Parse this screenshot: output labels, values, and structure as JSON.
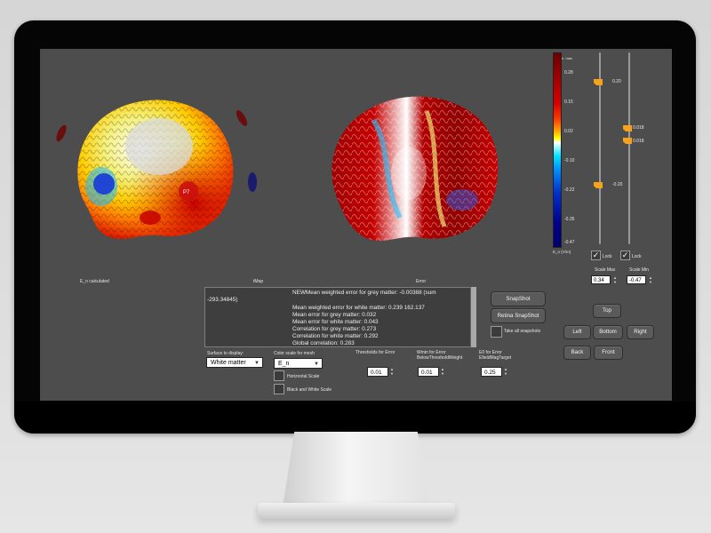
{
  "colors": {
    "screen_bg": "#4d4d4d",
    "accent_thumb": "#f7a21b",
    "button_bg": "#5a5a5a"
  },
  "viewports": {
    "left_label": "E_n calculated",
    "middle_label": "tMap",
    "right_label": "Error",
    "marker_label": "P7"
  },
  "colorbar": {
    "unit": "E_n (V/m)",
    "top_label": "n. max",
    "ticks": [
      "0.28",
      "0.15",
      "0.02",
      "-0.10",
      "-0.22",
      "-0.35",
      "-0.47"
    ],
    "colormap": "dark-red to yellow to white to cyan to dark-blue"
  },
  "scale_sliders": {
    "left": {
      "value_label": "0.20",
      "lower_label": "-0.20"
    },
    "right": {
      "value_label": "0.018",
      "lower_label": "0.018"
    },
    "lock_label": "Lock",
    "max_label": "Scale Max",
    "min_label": "Scale Min",
    "max_value": "0.34",
    "min_value": "-0.47"
  },
  "log": {
    "lines": [
      "NEWMean weighted error for grey matter: -0.00388 (sum",
      "-293.34845)",
      "Mean weighted error for white matter: 0.239 162.137",
      "Mean error for grey matter: 0.032",
      "Mean error for white matter: 0.043",
      "Correlation for grey matter: 0.273",
      "Correlation for white matter: 0.292",
      "Global correlation: 0.283"
    ]
  },
  "snapshot": {
    "snapshot_label": "SnapShot",
    "retina_label": "Retina SnapShot",
    "take_all_label": "Take all snapshots"
  },
  "views": {
    "top": "Top",
    "left": "Left",
    "bottom": "Bottom",
    "right": "Right",
    "back": "Back",
    "front": "Front"
  },
  "controls": {
    "surface_label": "Surface to display:",
    "surface_value": "White matter",
    "colorscale_label": "Color scale for mesh",
    "colorscale_value": "E_n",
    "horizontal_scale": "Horizontal Scale",
    "bw_scale": "Black and White Scale",
    "thresholds_label": "Thresholds for Error",
    "thresholds_value": "0.01",
    "wmin_label_1": "Wmin for Error",
    "wmin_label_2": "BelowThresholdWeight",
    "wmin_value": "0.01",
    "e0_label_1": "E0 for Error",
    "e0_label_2": "EfieldMagTarget",
    "e0_value": "0.25"
  }
}
